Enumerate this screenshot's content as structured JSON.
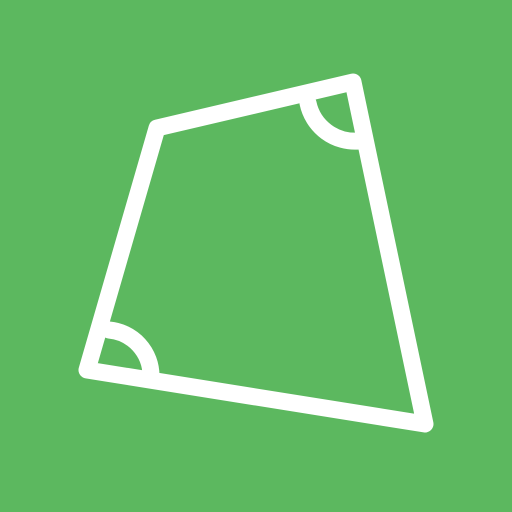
{
  "icon": {
    "name": "quadrilateral-angles-icon",
    "background_color": "#5cb85f",
    "stroke_color": "#ffffff"
  }
}
